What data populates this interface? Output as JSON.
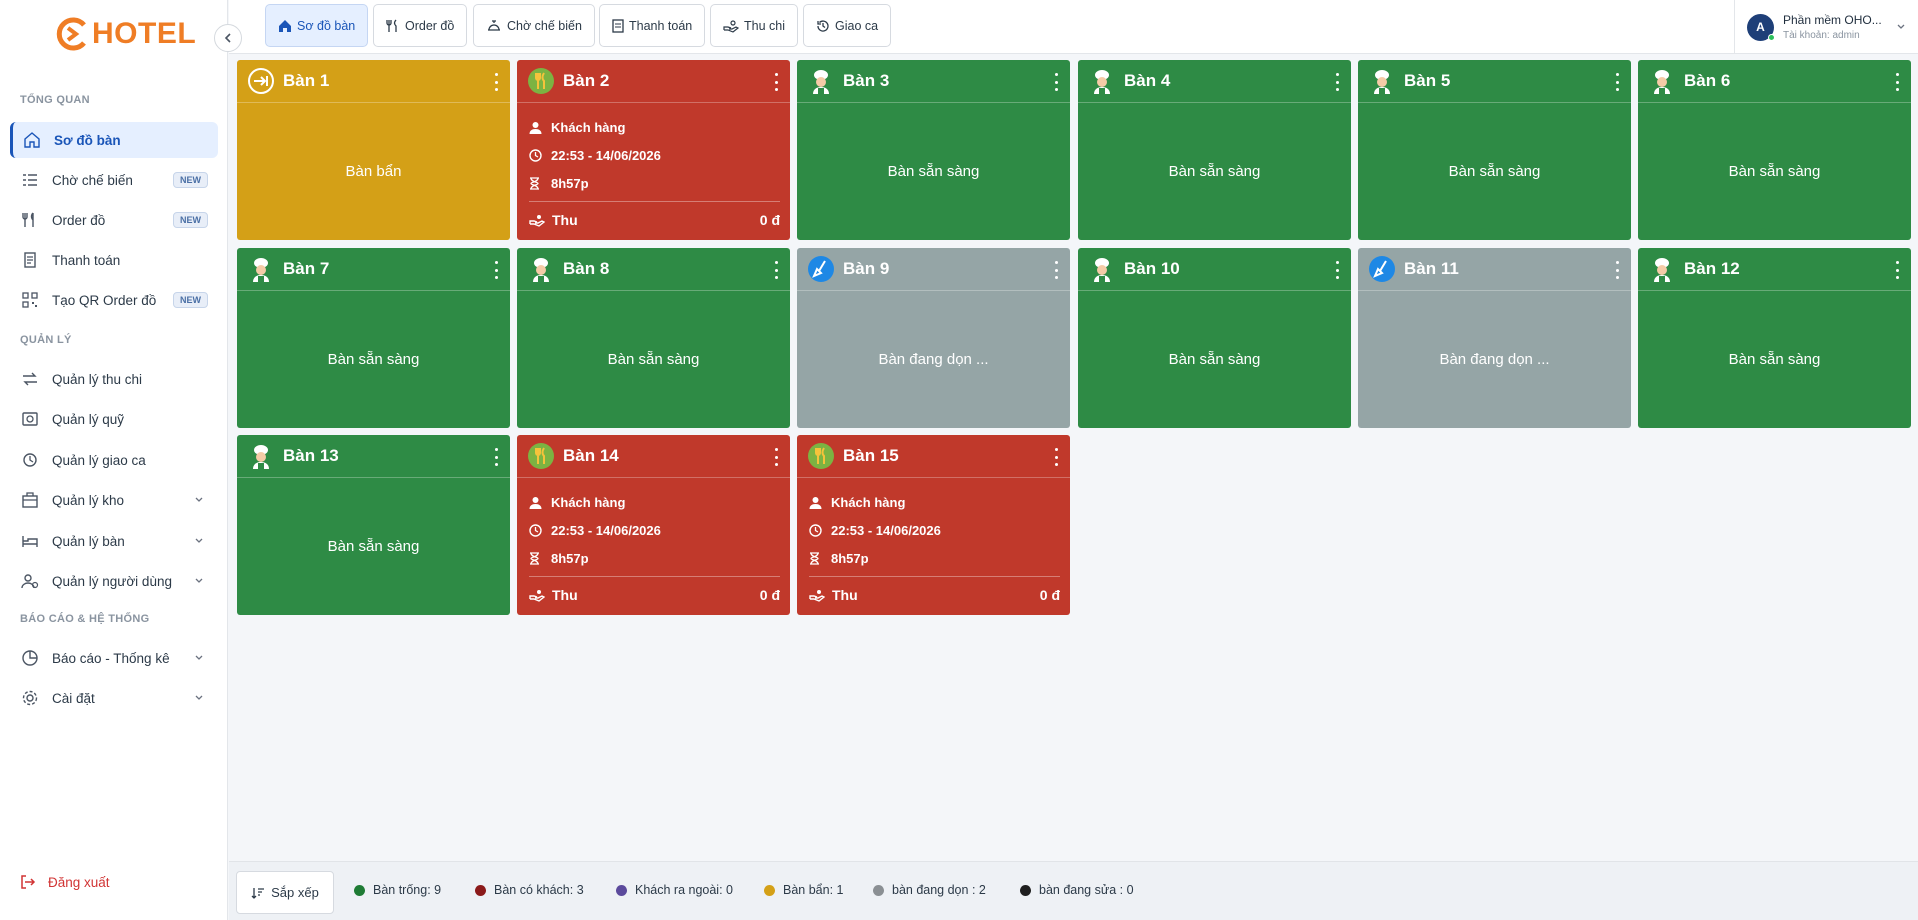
{
  "app": {
    "logo_text": "HOTEL",
    "brand_color": "#ef7d25"
  },
  "sidebar": {
    "sections": {
      "overview": "TỔNG QUAN",
      "manage": "QUẢN LÝ",
      "reports": "BÁO CÁO & HỆ THỐNG"
    },
    "items": [
      {
        "label": "Sơ đồ bàn",
        "icon": "home-icon",
        "active": true
      },
      {
        "label": "Chờ chế biến",
        "icon": "list-icon",
        "badge": "NEW"
      },
      {
        "label": "Order đồ",
        "icon": "utensils-icon",
        "badge": "NEW"
      },
      {
        "label": "Thanh toán",
        "icon": "receipt-icon"
      },
      {
        "label": "Tạo QR Order đồ",
        "icon": "qr-icon",
        "badge": "NEW"
      },
      {
        "label": "Quản lý thu chi",
        "icon": "transfer-icon"
      },
      {
        "label": "Quản lý quỹ",
        "icon": "safe-icon"
      },
      {
        "label": "Quản lý giao ca",
        "icon": "shift-icon"
      },
      {
        "label": "Quản lý kho",
        "icon": "box-icon"
      },
      {
        "label": "Quản lý bàn",
        "icon": "bed-icon"
      },
      {
        "label": "Quản lý người dùng",
        "icon": "users-icon"
      },
      {
        "label": "Báo cáo - Thống kê",
        "icon": "pie-icon"
      },
      {
        "label": "Cài đặt",
        "icon": "gear-icon"
      }
    ],
    "logout": "Đăng xuất"
  },
  "topbar": {
    "buttons": [
      {
        "label": "Sơ đồ bàn",
        "icon": "home-icon"
      },
      {
        "label": "Order đồ",
        "icon": "utensils-icon"
      },
      {
        "label": "Chờ chế biến",
        "icon": "chef-icon"
      },
      {
        "label": "Thanh toán",
        "icon": "receipt-icon"
      },
      {
        "label": "Thu chi",
        "icon": "hand-icon"
      },
      {
        "label": "Giao ca",
        "icon": "history-icon"
      }
    ],
    "user": {
      "initial": "A",
      "name": "Phần mềm OHO...",
      "account": "Tài khoản: admin"
    }
  },
  "tables": [
    {
      "name": "Bàn 1",
      "status": "Bàn bẩn",
      "color": "yellow"
    },
    {
      "name": "Bàn 2",
      "color": "red",
      "customer": "Khách hàng",
      "time": "22:53 - 14/06/2026",
      "duration": "8h57p",
      "thu": "Thu",
      "amount": "0 đ"
    },
    {
      "name": "Bàn 3",
      "status": "Bàn sẵn sàng",
      "color": "green"
    },
    {
      "name": "Bàn 4",
      "status": "Bàn sẵn sàng",
      "color": "green"
    },
    {
      "name": "Bàn 5",
      "status": "Bàn sẵn sàng",
      "color": "green"
    },
    {
      "name": "Bàn 6",
      "status": "Bàn sẵn sàng",
      "color": "green"
    },
    {
      "name": "Bàn 7",
      "status": "Bàn sẵn sàng",
      "color": "green"
    },
    {
      "name": "Bàn 8",
      "status": "Bàn sẵn sàng",
      "color": "green"
    },
    {
      "name": "Bàn 9",
      "status": "Bàn đang dọn ...",
      "color": "gray"
    },
    {
      "name": "Bàn 10",
      "status": "Bàn sẵn sàng",
      "color": "green"
    },
    {
      "name": "Bàn 11",
      "status": "Bàn đang dọn ...",
      "color": "gray"
    },
    {
      "name": "Bàn 12",
      "status": "Bàn sẵn sàng",
      "color": "green"
    },
    {
      "name": "Bàn 13",
      "status": "Bàn sẵn sàng",
      "color": "green"
    },
    {
      "name": "Bàn 14",
      "color": "red",
      "customer": "Khách hàng",
      "time": "22:53 - 14/06/2026",
      "duration": "8h57p",
      "thu": "Thu",
      "amount": "0 đ"
    },
    {
      "name": "Bàn 15",
      "color": "red",
      "customer": "Khách hàng",
      "time": "22:53 - 14/06/2026",
      "duration": "8h57p",
      "thu": "Thu",
      "amount": "0 đ"
    }
  ],
  "bottombar": {
    "sort_label": "Sắp xếp",
    "legend": [
      {
        "label": "Bàn trống: 9",
        "color": "#1e7b34"
      },
      {
        "label": "Bàn có khách: 3",
        "color": "#8b1a1a"
      },
      {
        "label": "Khách ra ngoài: 0",
        "color": "#5b4a9c"
      },
      {
        "label": "Bàn bẩn: 1",
        "color": "#d4a017"
      },
      {
        "label": "bàn đang dọn : 2",
        "color": "#8a8f93"
      },
      {
        "label": "bàn đang sửa : 0",
        "color": "#1f1f1f"
      }
    ]
  }
}
